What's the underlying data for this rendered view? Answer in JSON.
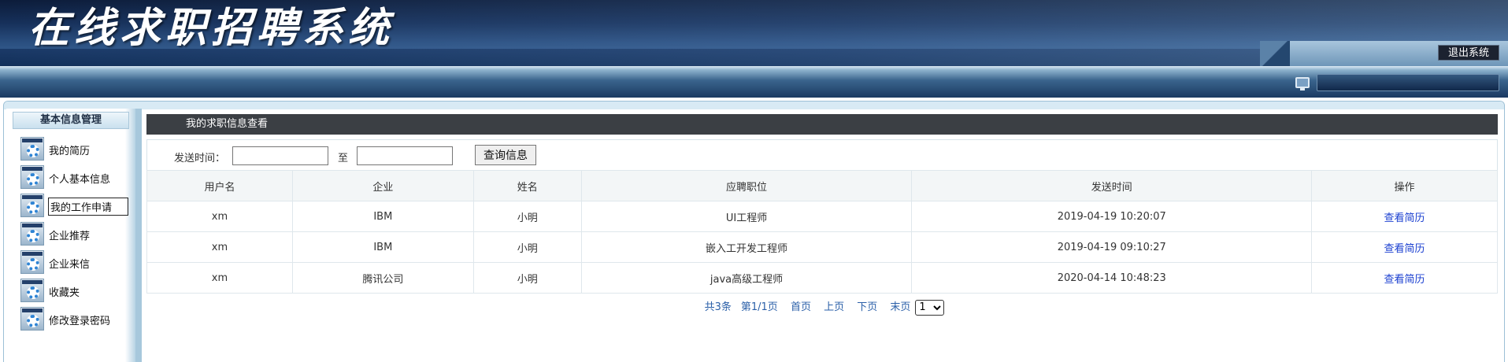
{
  "header": {
    "site_title": "在线求职招聘系统",
    "logout_label": "退出系统"
  },
  "sidebar": {
    "section_title": "基本信息管理",
    "items": [
      {
        "label": "我的简历",
        "icon": "gear-icon"
      },
      {
        "label": "个人基本信息",
        "icon": "gear-icon"
      },
      {
        "label": "我的工作申请",
        "icon": "gear-icon",
        "active": true
      },
      {
        "label": "企业推荐",
        "icon": "gear-icon"
      },
      {
        "label": "企业来信",
        "icon": "gear-icon"
      },
      {
        "label": "收藏夹",
        "icon": "gear-icon"
      },
      {
        "label": "修改登录密码",
        "icon": "gear-icon"
      }
    ]
  },
  "main": {
    "title": "我的求职信息查看",
    "filter": {
      "label": "发送时间：",
      "to_label": "至",
      "from_value": "",
      "to_value": "",
      "query_button": "查询信息"
    },
    "table": {
      "columns": [
        "用户名",
        "企业",
        "姓名",
        "应聘职位",
        "发送时间",
        "操作"
      ],
      "rows": [
        {
          "username": "xm",
          "company": "IBM",
          "name": "小明",
          "position": "UI工程师",
          "sent_time": "2019-04-19 10:20:07",
          "action": "查看简历"
        },
        {
          "username": "xm",
          "company": "IBM",
          "name": "小明",
          "position": "嵌入工开发工程师",
          "sent_time": "2019-04-19 09:10:27",
          "action": "查看简历"
        },
        {
          "username": "xm",
          "company": "腾讯公司",
          "name": "小明",
          "position": "java高级工程师",
          "sent_time": "2020-04-14 10:48:23",
          "action": "查看简历"
        }
      ]
    },
    "pager": {
      "total": "共3条",
      "page_info": "第1/1页",
      "first": "首页",
      "prev": "上页",
      "next": "下页",
      "last": "末页",
      "selected_page": "1"
    }
  },
  "colors": {
    "header_dark": "#0c1c3a",
    "title_bar": "#3b3f44",
    "link_blue": "#1a3fd0",
    "pager_blue": "#2a5fa8"
  }
}
